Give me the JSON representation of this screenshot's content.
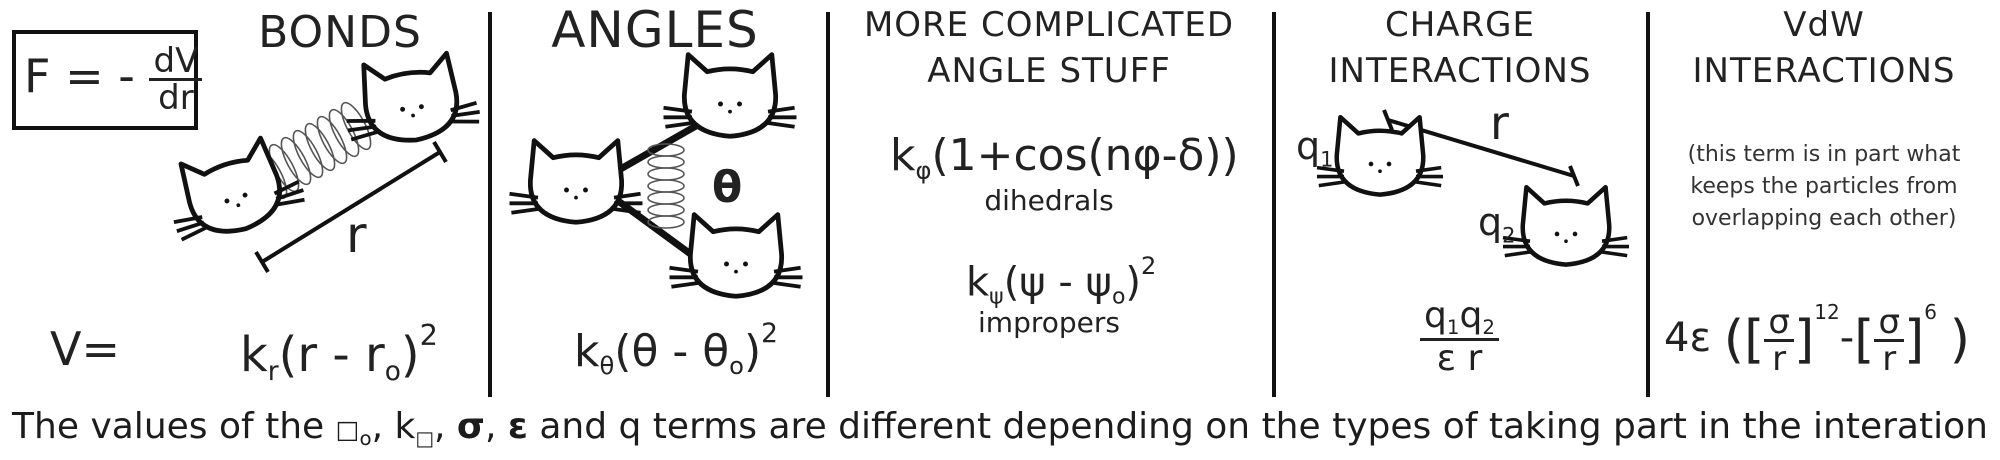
{
  "force_box": {
    "lhs": "F = -",
    "num": "dV",
    "den": "dr"
  },
  "bonds": {
    "title": "BONDS",
    "r_label": "r",
    "v_label": "V=",
    "formula": {
      "k": "k",
      "k_sub": "r",
      "body": "(r - r",
      "r0_sub": "o",
      "close": ")",
      "power": "2"
    }
  },
  "angles": {
    "title": "ANGLES",
    "theta_label": "θ",
    "formula": {
      "k": "k",
      "k_sub": "θ",
      "body": "(θ - θ",
      "sub": "o",
      "close": ")",
      "power": "2"
    }
  },
  "complicated": {
    "title_line1": "MORE COMPLICATED",
    "title_line2": "ANGLE STUFF",
    "dihedral": {
      "k": "k",
      "k_sub": "φ",
      "body": "(1+cos(nφ-δ))"
    },
    "dihedral_label": "dihedrals",
    "improper": {
      "k": "k",
      "k_sub": "ψ",
      "body": "(ψ - ψ",
      "sub": "o",
      "close": ")",
      "power": "2"
    },
    "improper_label": "impropers"
  },
  "charge": {
    "title_line1": "CHARGE",
    "title_line2": "INTERACTIONS",
    "r_label": "r",
    "q1": "q",
    "q1_sub": "1",
    "q2": "q",
    "q2_sub": "2",
    "formula": {
      "num": "q",
      "num_sub1": "1",
      "num2": "q",
      "num_sub2": "2",
      "den": "ε r"
    }
  },
  "vdw": {
    "title_line1": "VdW",
    "title_line2": "INTERACTIONS",
    "note_line1": "(this term is in part what",
    "note_line2": "keeps the particles from",
    "note_line3": "overlapping each other)",
    "formula": {
      "prefix": "4ε",
      "sigma": "σ",
      "r": "r",
      "pow1": "12",
      "minus": "-",
      "pow2": "6"
    }
  },
  "caption": {
    "before": "The values of the ",
    "box1": "□",
    "box1_sub": "o",
    "comma1": ", k",
    "box2_sub": "□",
    "comma2": ", ",
    "sigma": "σ",
    "comma3": ", ",
    "epsilon": "ε",
    "after": " and q terms are different depending on the types of taking part in the interation"
  }
}
